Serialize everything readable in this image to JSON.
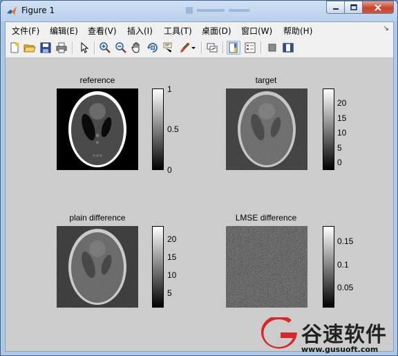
{
  "window": {
    "title": "Figure 1"
  },
  "menu": [
    "文件(F)",
    "编辑(E)",
    "查看(V)",
    "插入(I)",
    "工具(T)",
    "桌面(D)",
    "窗口(W)",
    "帮助(H)"
  ],
  "toolbar": {
    "icons": [
      "new-figure-icon",
      "open-file-icon",
      "save-icon",
      "print-icon",
      "pointer-icon",
      "zoom-in-icon",
      "zoom-out-icon",
      "pan-hand-icon",
      "rotate-3d-icon",
      "data-cursor-icon",
      "brush-icon",
      "brush-dropdown-icon",
      "link-plot-icon",
      "colorbar-icon",
      "legend-icon",
      "hide-plot-tools-icon",
      "show-plot-tools-icon"
    ]
  },
  "axes": [
    {
      "title": "reference",
      "ticks": [
        "1",
        "0.5",
        "0"
      ]
    },
    {
      "title": "target",
      "ticks": [
        "20",
        "15",
        "10",
        "5",
        "0"
      ]
    },
    {
      "title": "plain difference",
      "ticks": [
        "20",
        "15",
        "10",
        "5"
      ]
    },
    {
      "title": "LMSE difference",
      "ticks": [
        "0.15",
        "0.1",
        "0.05"
      ]
    }
  ],
  "watermark": {
    "brand": "谷速软件",
    "url": "www.gusuoft.com"
  }
}
